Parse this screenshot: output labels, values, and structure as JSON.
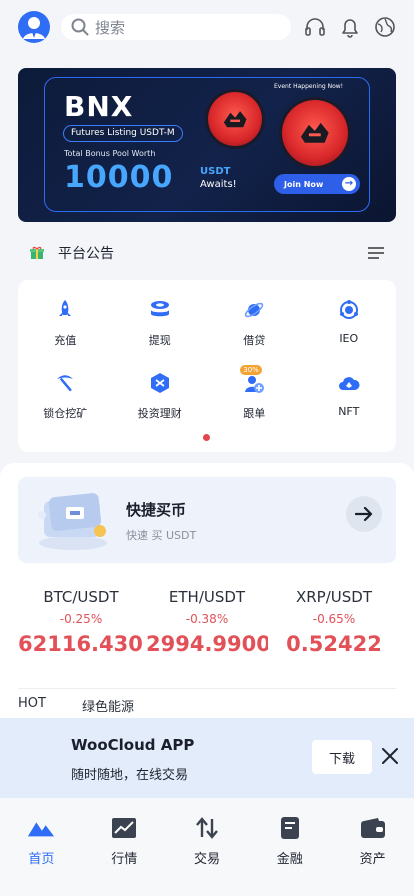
{
  "search": {
    "placeholder": "搜索"
  },
  "banner": {
    "title": "BNX",
    "pill": "Futures Listing USDT-M",
    "bonus_label": "Total Bonus Pool Worth",
    "amount": "10000",
    "unit": "USDT",
    "awaits": "Awaits!",
    "event": "Event Happening Now!",
    "join": "Join Now"
  },
  "announcement": {
    "label": "平台公告"
  },
  "grid": [
    {
      "label": "充值",
      "icon": "rocket-icon"
    },
    {
      "label": "提现",
      "icon": "coins-icon"
    },
    {
      "label": "借贷",
      "icon": "planet-icon"
    },
    {
      "label": "IEO",
      "icon": "ieo-icon"
    },
    {
      "label": "锁仓挖矿",
      "icon": "pickaxe-icon"
    },
    {
      "label": "投资理财",
      "icon": "invest-icon"
    },
    {
      "label": "跟单",
      "icon": "copy-trade-icon",
      "badge": "30%"
    },
    {
      "label": "NFT",
      "icon": "nft-cloud-icon"
    }
  ],
  "quick_buy": {
    "title": "快捷买币",
    "subtitle": "快速 买 USDT"
  },
  "tickers": [
    {
      "pair": "BTC/USDT",
      "change": "-0.25%",
      "price": "62116.43000"
    },
    {
      "pair": "ETH/USDT",
      "change": "-0.38%",
      "price": "2994.99000"
    },
    {
      "pair": "XRP/USDT",
      "change": "-0.65%",
      "price": "0.52422"
    }
  ],
  "tabs": [
    "HOT",
    "绿色能源"
  ],
  "app_bar": {
    "name": "WooCloud APP",
    "desc": "随时随地，在线交易",
    "download": "下载"
  },
  "nav": [
    {
      "label": "首页",
      "active": true
    },
    {
      "label": "行情"
    },
    {
      "label": "交易"
    },
    {
      "label": "金融"
    },
    {
      "label": "资产"
    }
  ],
  "colors": {
    "accent": "#2f6df6",
    "down": "#e15157"
  }
}
